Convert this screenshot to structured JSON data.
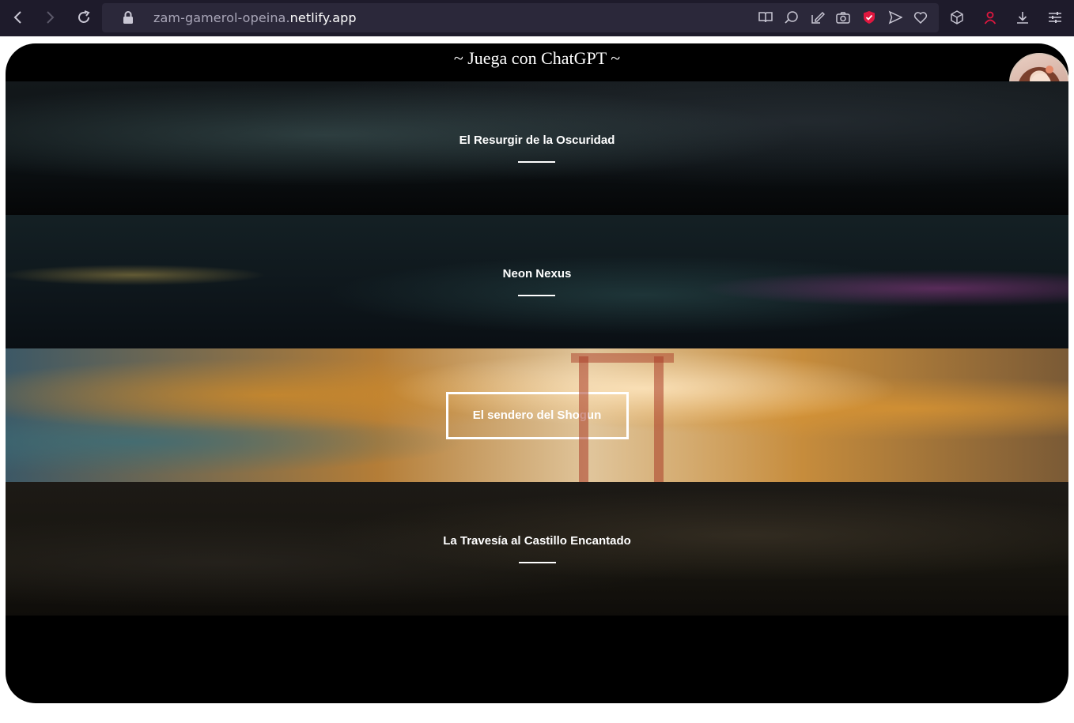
{
  "browser": {
    "url_path": "zam-gamerol-opeina.",
    "url_host": "netlify.app",
    "accent_color": "#e0173f"
  },
  "page": {
    "title": "~ Juega con ChatGPT ~",
    "avatar_icon": "anime-girl-avatar",
    "games": [
      {
        "title": "El Resurgir de la Oscuridad"
      },
      {
        "title": "Neon Nexus"
      },
      {
        "title": "El sendero del Shogun"
      },
      {
        "title": "La Travesía al Castillo Encantado"
      }
    ]
  }
}
